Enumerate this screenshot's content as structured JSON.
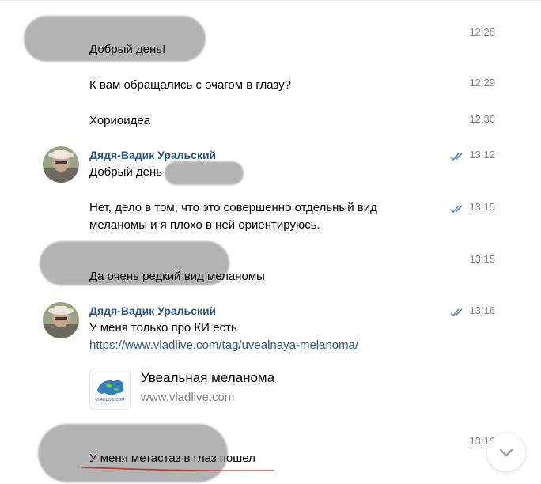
{
  "messages": [
    {
      "text": "Добрый день!",
      "time": "12:28"
    },
    {
      "text": "К вам обращались с очагом в глазу?",
      "time": "12:29"
    },
    {
      "text": "Хориоидеа",
      "time": "12:30"
    },
    {
      "author": "Дядя-Вадик Уральский",
      "text": "Добрый день",
      "time": "13:12"
    },
    {
      "text": "Нет, дело в том, что это совершенно отдельный вид",
      "text2": "меланомы и я плохо в ней ориентируюсь.",
      "time": "13:15"
    },
    {
      "text": "Да очень редкий вид меланомы",
      "time": "13:15"
    },
    {
      "author": "Дядя-Вадик Уральский",
      "text": "У меня только про КИ  есть",
      "link": "https://www.vladlive.com/tag/uvealnaya-melanoma/",
      "time": "13:16"
    },
    {
      "text": "У меня метастаз в глаз пошел",
      "time": "13:16"
    }
  ],
  "snippet": {
    "title": "Увеальная меланома",
    "domain": "www.vladlive.com",
    "logo_text": "VLADLIVE.COM"
  },
  "icons": {
    "read": "double-check-icon",
    "scroll": "chevron-down-icon"
  },
  "colors": {
    "author": "#2a5885",
    "link": "#2a5885",
    "time": "#828282",
    "check": "#5181b8",
    "underline": "#c0392b"
  }
}
